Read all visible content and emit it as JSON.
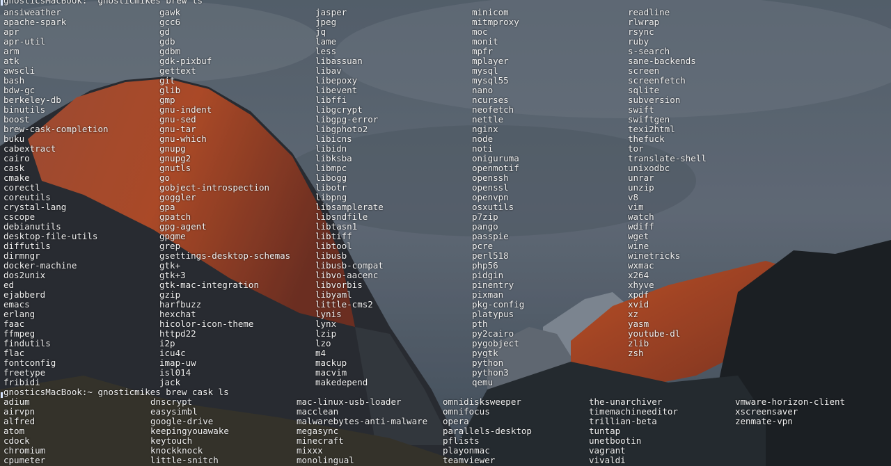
{
  "prompt1": {
    "text": "gnosticsMacBook:  gnosticmikes brew ls"
  },
  "prompt2": {
    "text": "gnosticsMacBook:~ gnosticmikes brew cask ls"
  },
  "brew_columns": [
    [
      "ansiweather",
      "apache-spark",
      "apr",
      "apr-util",
      "arm",
      "atk",
      "awscli",
      "bash",
      "bdw-gc",
      "berkeley-db",
      "binutils",
      "boost",
      "brew-cask-completion",
      "buku",
      "cabextract",
      "cairo",
      "cask",
      "cmake",
      "corectl",
      "coreutils",
      "crystal-lang",
      "cscope",
      "debianutils",
      "desktop-file-utils",
      "diffutils",
      "dirmngr",
      "docker-machine",
      "dos2unix",
      "ed",
      "ejabberd",
      "emacs",
      "erlang",
      "faac",
      "ffmpeg",
      "findutils",
      "flac",
      "fontconfig",
      "freetype",
      "fribidi"
    ],
    [
      "gawk",
      "gcc6",
      "gd",
      "gdb",
      "gdbm",
      "gdk-pixbuf",
      "gettext",
      "git",
      "glib",
      "gmp",
      "gnu-indent",
      "gnu-sed",
      "gnu-tar",
      "gnu-which",
      "gnupg",
      "gnupg2",
      "gnutls",
      "go",
      "gobject-introspection",
      "goggler",
      "gpa",
      "gpatch",
      "gpg-agent",
      "gpgme",
      "grep",
      "gsettings-desktop-schemas",
      "gtk+",
      "gtk+3",
      "gtk-mac-integration",
      "gzip",
      "harfbuzz",
      "hexchat",
      "hicolor-icon-theme",
      "httpd22",
      "i2p",
      "icu4c",
      "imap-uw",
      "isl014",
      "jack"
    ],
    [
      "jasper",
      "jpeg",
      "jq",
      "lame",
      "less",
      "libassuan",
      "libav",
      "libepoxy",
      "libevent",
      "libffi",
      "libgcrypt",
      "libgpg-error",
      "libgphoto2",
      "libicns",
      "libidn",
      "libksba",
      "libmpc",
      "libogg",
      "libotr",
      "libpng",
      "libsamplerate",
      "libsndfile",
      "libtasn1",
      "libtiff",
      "libtool",
      "libusb",
      "libusb-compat",
      "libvo-aacenc",
      "libvorbis",
      "libyaml",
      "little-cms2",
      "lynis",
      "lynx",
      "lzip",
      "lzo",
      "m4",
      "mackup",
      "macvim",
      "makedepend"
    ],
    [
      "minicom",
      "mitmproxy",
      "moc",
      "monit",
      "mpfr",
      "mplayer",
      "mysql",
      "mysql55",
      "nano",
      "ncurses",
      "neofetch",
      "nettle",
      "nginx",
      "node",
      "noti",
      "oniguruma",
      "openmotif",
      "openssh",
      "openssl",
      "openvpn",
      "osxutils",
      "p7zip",
      "pango",
      "passpie",
      "pcre",
      "perl518",
      "php56",
      "pidgin",
      "pinentry",
      "pixman",
      "pkg-config",
      "platypus",
      "pth",
      "py2cairo",
      "pygobject",
      "pygtk",
      "python",
      "python3",
      "qemu"
    ],
    [
      "readline",
      "rlwrap",
      "rsync",
      "ruby",
      "s-search",
      "sane-backends",
      "screen",
      "screenfetch",
      "sqlite",
      "subversion",
      "swift",
      "swiftgen",
      "texi2html",
      "thefuck",
      "tor",
      "translate-shell",
      "unixodbc",
      "unrar",
      "unzip",
      "v8",
      "vim",
      "watch",
      "wdiff",
      "wget",
      "wine",
      "winetricks",
      "wxmac",
      "x264",
      "xhyve",
      "xpdf",
      "xvid",
      "xz",
      "yasm",
      "youtube-dl",
      "zlib",
      "zsh"
    ]
  ],
  "cask_columns": [
    [
      "adium",
      "airvpn",
      "alfred",
      "atom",
      "cdock",
      "chromium",
      "cpumeter"
    ],
    [
      "dnscrypt",
      "easysimbl",
      "google-drive",
      "keepingyouawake",
      "keytouch",
      "knockknock",
      "little-snitch"
    ],
    [
      "mac-linux-usb-loader",
      "macclean",
      "malwarebytes-anti-malware",
      "megasync",
      "minecraft",
      "mixxx",
      "monolingual"
    ],
    [
      "omnidisksweeper",
      "omnifocus",
      "opera",
      "parallels-desktop",
      "pflists",
      "playonmac",
      "teamviewer"
    ],
    [
      "the-unarchiver",
      "timemachineeditor",
      "trillian-beta",
      "tuntap",
      "unetbootin",
      "vagrant",
      "vivaldi"
    ],
    [
      "vmware-horizon-client",
      "xscreensaver",
      "zenmate-vpn"
    ]
  ]
}
